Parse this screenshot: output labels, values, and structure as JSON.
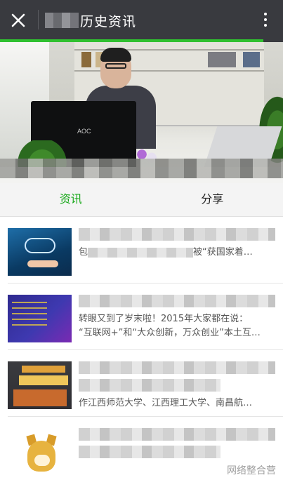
{
  "topbar": {
    "title": "历史资讯",
    "close_icon": "close-icon",
    "more_icon": "more-vertical-icon"
  },
  "progress": {
    "fraction": 0.93,
    "color": "#30c130"
  },
  "banner": {
    "monitor_label": "AOC"
  },
  "tabs": [
    {
      "label": "资讯",
      "active": true
    },
    {
      "label": "分享",
      "active": false
    }
  ],
  "news": [
    {
      "snippet": "包",
      "snippet2": "被“获国家着…",
      "thumb": "cloud"
    },
    {
      "snippet": "转眼又到了岁末啦！2015年大家都在说：",
      "snippet2": "“互联网+”和“大众创新，万众创业”本土互…",
      "thumb": "ppt"
    },
    {
      "snippet": "作江西师范大学、江西理工大学、南昌航…",
      "snippet2": "",
      "thumb": "edu"
    },
    {
      "snippet": "",
      "snippet2": "",
      "thumb": "doge"
    }
  ],
  "watermark": "网络整合营",
  "colors": {
    "accent": "#18a81a",
    "header": "#393a3f"
  }
}
